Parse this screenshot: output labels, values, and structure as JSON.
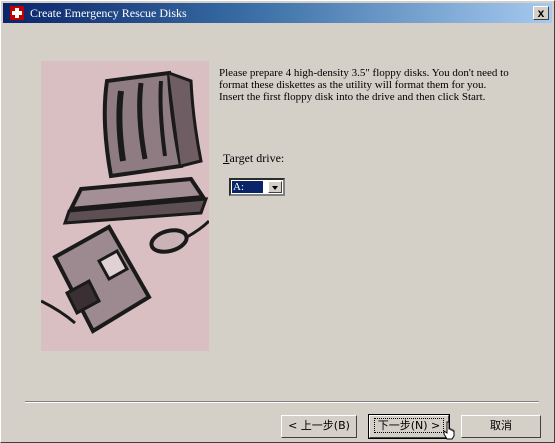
{
  "window": {
    "title": "Create Emergency Rescue Disks",
    "close_label": "x"
  },
  "wizard": {
    "instruction_line1": "Please prepare 4 high-density 3.5\" floppy disks. You don't need to format these diskettes as the utility will format them for you.",
    "instruction_line2": "Insert the first floppy disk into the drive and then click Start.",
    "target_label_prefix": "T",
    "target_label_rest": "arget drive:",
    "drive_value": "A:"
  },
  "buttons": {
    "back_label": "< 上一步(B)",
    "next_label": "下一步(N) >",
    "cancel_label": "取消"
  },
  "colors": {
    "titlebar_start": "#0a246a",
    "titlebar_end": "#a6caf0",
    "face": "#d4d0c8",
    "illustration_bg": "#d9bfc2"
  }
}
